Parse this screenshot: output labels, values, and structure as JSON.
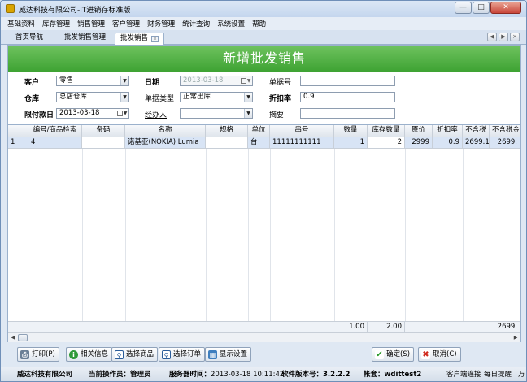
{
  "window": {
    "title": "威达科技有限公司-IT进销存标准版"
  },
  "menu": [
    "基础资料",
    "库存管理",
    "销售管理",
    "客户管理",
    "财务管理",
    "统计查询",
    "系统设置",
    "帮助"
  ],
  "tabs": [
    {
      "label": "首页导航"
    },
    {
      "label": "批发销售管理"
    },
    {
      "label": "批发销售"
    }
  ],
  "banner": "新增批发销售",
  "form": {
    "customer_label": "客户",
    "customer_value": "零售",
    "date_label": "日期",
    "date_value": "2013-03-18",
    "bill_no_label": "单据号",
    "bill_no_value": "",
    "warehouse_label": "仓库",
    "warehouse_value": "总店仓库",
    "bill_type_label": "单据类型",
    "bill_type_value": "正常出库",
    "discount_label": "折扣率",
    "discount_value": "0.9",
    "pay_date_label": "限付款日",
    "pay_date_value": "2013-03-18",
    "handler_label": "经办人",
    "handler_value": "",
    "remark_label": "摘要",
    "remark_value": ""
  },
  "grid": {
    "columns": [
      "编号/商品检索",
      "条码",
      "名称",
      "规格",
      "单位",
      "串号",
      "数量",
      "库存数量",
      "原价",
      "折扣率",
      "不含税",
      "不含税金"
    ],
    "rows": [
      {
        "idx": "1",
        "code": "4",
        "barcode": "",
        "name": "诺基亚(NOKIA) Lumia",
        "spec": "",
        "unit": "台",
        "serial": "11111111111",
        "qty": "1",
        "stock": "2",
        "price": "2999",
        "discount": "0.9",
        "net": "2699.1",
        "net_amount": "2699."
      }
    ],
    "totals": {
      "qty": "1.00",
      "stock": "2.00",
      "net_amount": "2699."
    }
  },
  "toolbar": {
    "print": "打印(P)",
    "related": "相关信息",
    "select_goods": "选择商品",
    "select_order": "选择订单",
    "display": "显示设置",
    "confirm": "确定(S)",
    "cancel": "取消(C)"
  },
  "status": {
    "company": "威达科技有限公司",
    "operator_label": "当前操作员：",
    "operator": "管理员",
    "server_time_label": "服务器时间：",
    "server_time": "2013-03-18 10:11:42",
    "version_label": "软件版本号：",
    "version": "3.2.2.2",
    "account_label": "帐套：",
    "account": "wdittest2",
    "client": "客户端连接",
    "reminder": "每日提醒",
    "more": "万"
  },
  "colors": {
    "banner": "#3ea333",
    "row_highlight": "#d8e4f5"
  }
}
